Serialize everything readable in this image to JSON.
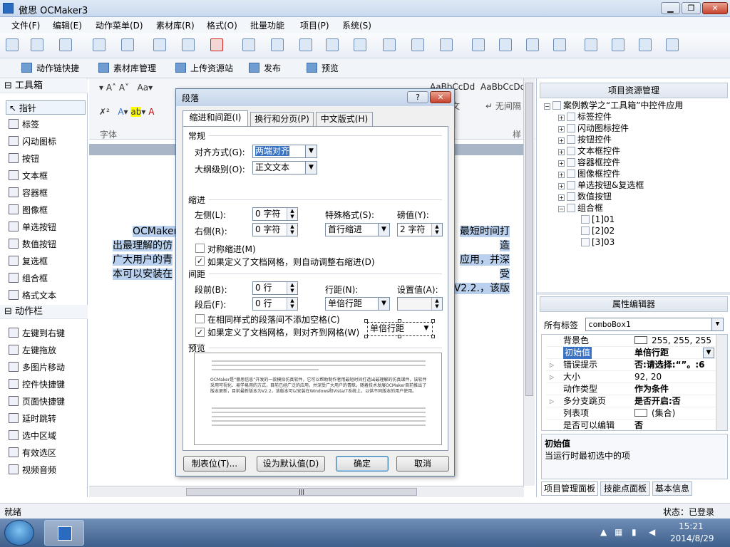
{
  "window": {
    "title": "傲思 OCMaker3",
    "min": "▁",
    "max": "❐",
    "close": "✕"
  },
  "menu": [
    "文件(F)",
    "编辑(E)",
    "动作菜单(D)",
    "素材库(R)",
    "格式(O)",
    "批量功能",
    "项目(P)",
    "系统(S)"
  ],
  "quickbar": [
    "动作链快捷",
    "素材库管理",
    "上传资源站",
    "发布",
    "预览"
  ],
  "toolbox": {
    "section1": "工具箱",
    "tools": [
      "指针",
      "标签",
      "闪动图标",
      "按钮",
      "文本框",
      "容器框",
      "图像框",
      "单选按钮",
      "数值按钮",
      "复选框",
      "组合框",
      "格式文本"
    ],
    "section2": "动作栏",
    "actions": [
      "左键到右键",
      "左键拖放",
      "多图片移动",
      "控件快捷键",
      "页面快捷键",
      "延时跳转",
      "选中区域",
      "有效选区",
      "视频音频"
    ]
  },
  "doc": {
    "ribbon_font_label": "字体",
    "ribbon_style_label": "样",
    "style1": "AaBbCcDd",
    "style2": "AaBbCcDd",
    "style2_sub": "无间隔",
    "style1_sub": "文",
    "line1": "OCMaker",
    "line1_tail": "最短时间打造",
    "line2": "出最理解的仿",
    "line2_tail": "应用，并深受",
    "line3": "广大用户的青",
    "line3_tail": "V2.2.，该版",
    "line4": "本可以安装在"
  },
  "dialog": {
    "title": "段落",
    "help": "?",
    "close": "✕",
    "tabs": [
      "缩进和间距(I)",
      "换行和分页(P)",
      "中文版式(H)"
    ],
    "general": "常规",
    "align_label": "对齐方式(G):",
    "align_value": "两端对齐",
    "outline_label": "大纲级别(O):",
    "outline_value": "正文文本",
    "indent": "缩进",
    "left_label": "左侧(L):",
    "left_value": "0 字符",
    "right_label": "右侧(R):",
    "right_value": "0 字符",
    "special_label": "特殊格式(S):",
    "special_value": "首行缩进",
    "measure_label": "磅值(Y):",
    "measure_value": "2 字符",
    "mirror": "对称缩进(M)",
    "autoright": "如果定义了文档网格，则自动调整右缩进(D)",
    "spacing": "间距",
    "before_label": "段前(B):",
    "before_value": "0 行",
    "after_label": "段后(F):",
    "after_value": "0 行",
    "linesp_label": "行距(N):",
    "linesp_value": "单倍行距",
    "setval_label": "设置值(A):",
    "nospace": "在相同样式的段落间不添加空格(C)",
    "snapgrid": "如果定义了文档网格，则对齐到网格(W)",
    "overlay_combo": "单倍行距",
    "preview": "预览",
    "preview_text": "OCMaker是“傲思信息”开发的一款模拟仿真软件，它可以帮助制作者用最短时间打造出最理解的仿真课件，该软件采用可视化、易学易用的方式，目前已经广泛的应用，并深受广大用户的青睐，随着技术发展OCMaker目前推出了版本更新，目前最新版本为V2.2，该版本可以安装在Windows和Vista/7系统上，以供不同版本的用户使用。",
    "btn_tabs": "制表位(T)...",
    "btn_default": "设为默认值(D)",
    "btn_ok": "确定",
    "btn_cancel": "取消"
  },
  "project": {
    "header": "项目资源管理",
    "root": "案例教学之“工具箱”中控件应用",
    "nodes": [
      "标签控件",
      "闪动图标控件",
      "按钮控件",
      "文本框控件",
      "容器框控件",
      "图像框控件",
      "单选按钮&复选框",
      "数值按钮",
      "组合框"
    ],
    "children": [
      "[1]01",
      "[2]02",
      "[3]03"
    ]
  },
  "props": {
    "header": "属性编辑器",
    "tag_label": "所有标签",
    "tag_value": "comboBox1",
    "rows": [
      {
        "k": "背景色",
        "v": "255, 255, 255"
      },
      {
        "k": "初始值",
        "v": "单倍行距"
      },
      {
        "k": "错误提示",
        "v": "否:请选择:“”。:6"
      },
      {
        "k": "大小",
        "v": "92, 20"
      },
      {
        "k": "动作类型",
        "v": "作为条件"
      },
      {
        "k": "多分支跳页",
        "v": "是否开启:否"
      },
      {
        "k": "列表项",
        "v": "(集合)"
      },
      {
        "k": "是否可以编辑",
        "v": "否"
      }
    ],
    "desc_title": "初始值",
    "desc_text": "当运行时最初选中的项"
  },
  "bottom_tabs": [
    "项目管理面板",
    "技能点面板",
    "基本信息"
  ],
  "status": {
    "left": "就绪",
    "right": "状态：已登录"
  },
  "taskbar": {
    "time": "15:21",
    "date": "2014/8/29"
  }
}
